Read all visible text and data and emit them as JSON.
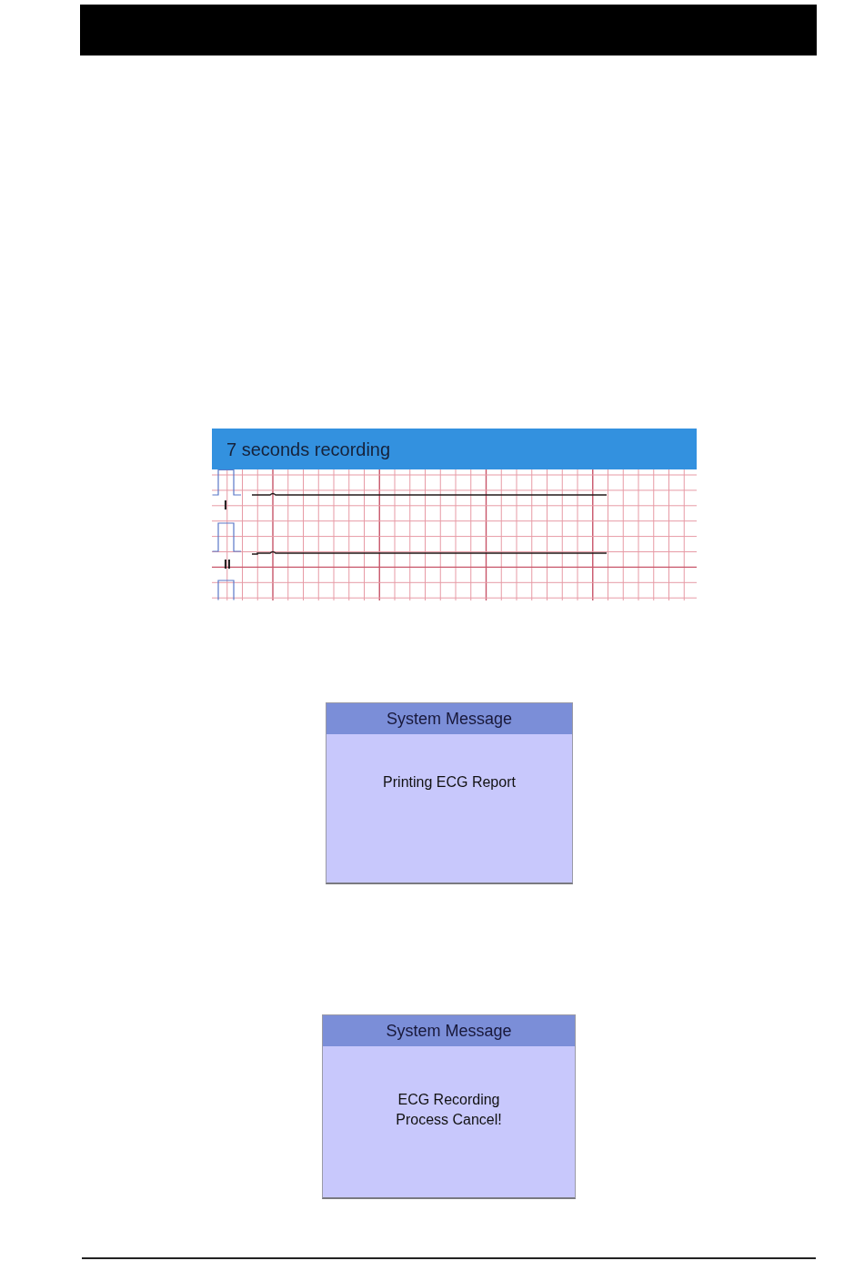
{
  "ecg_screen": {
    "title": "7 seconds recording",
    "leads": [
      {
        "label": "I"
      },
      {
        "label": "II"
      }
    ]
  },
  "messages": [
    {
      "title": "System Message",
      "text": "Printing ECG Report"
    },
    {
      "title": "System Message",
      "text": "ECG Recording\nProcess Cancel!"
    }
  ]
}
